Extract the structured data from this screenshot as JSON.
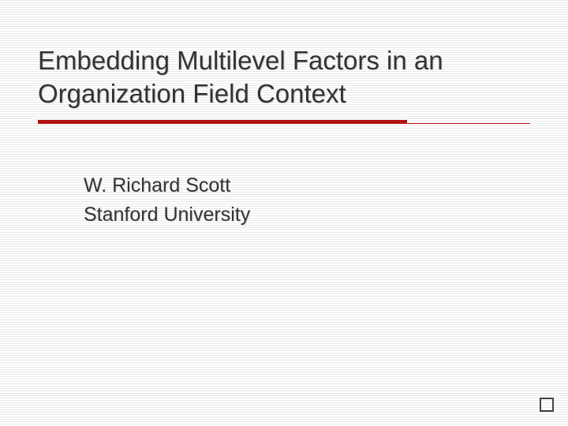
{
  "slide": {
    "title": "Embedding Multilevel Factors in an Organization Field Context",
    "author": "W. Richard Scott",
    "affiliation": "Stanford University"
  }
}
